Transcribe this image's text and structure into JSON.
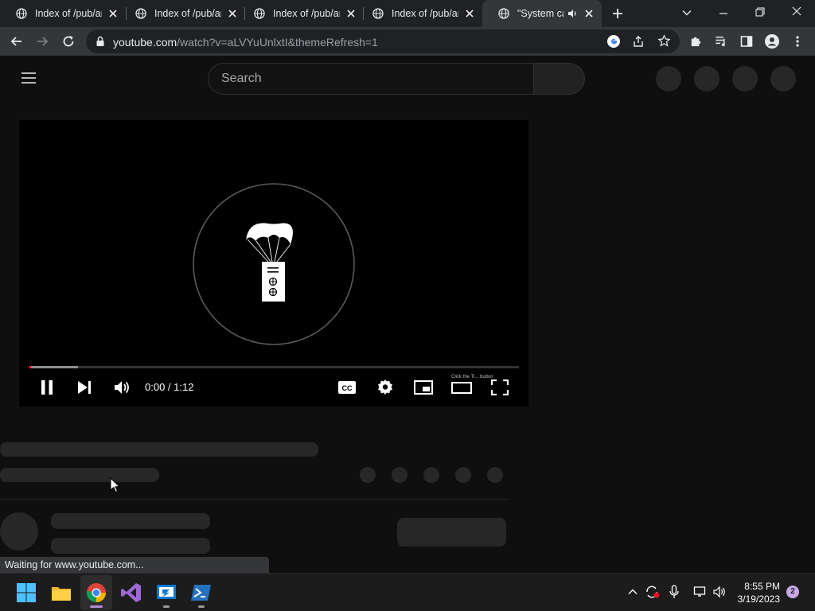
{
  "browser": {
    "tabs": [
      {
        "title": "Index of /pub/android",
        "active": false
      },
      {
        "title": "Index of /pub/android",
        "active": false
      },
      {
        "title": "Index of /pub/android",
        "active": false
      },
      {
        "title": "Index of /pub/android",
        "active": false
      },
      {
        "title": "\"System can't boot",
        "active": true,
        "audio": true
      }
    ],
    "url_host": "youtube.com",
    "url_rest": "/watch?v=aLVYuUnlxtI&themeRefresh=1",
    "status_text": "Waiting for www.youtube.com..."
  },
  "youtube": {
    "search_placeholder": "Search"
  },
  "player": {
    "time_display": "0:00 / 1:12",
    "progress_fraction": 0.1,
    "watermark_text": "Click the Ti... button"
  },
  "taskbar": {
    "time": "8:55 PM",
    "date": "3/19/2023",
    "notification_count": "2"
  },
  "colors": {
    "page_bg": "#0f0f0f",
    "progress_red": "#ff0000",
    "skeleton": "#272727",
    "notif_badge": "#c8a8e9"
  }
}
